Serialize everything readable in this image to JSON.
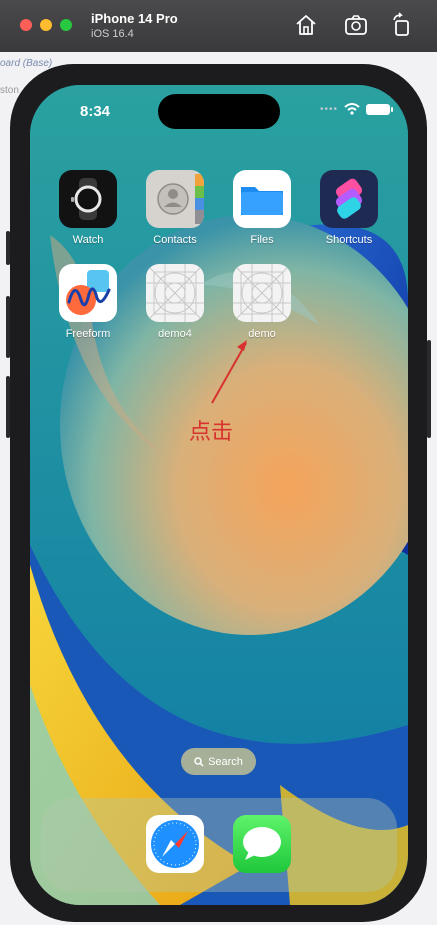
{
  "simulator": {
    "device_name": "iPhone 14 Pro",
    "os_version": "iOS 16.4",
    "toolbar": [
      "home-icon",
      "screenshot-icon",
      "rotate-icon"
    ]
  },
  "background": {
    "partial_text_1": "oard (Base)",
    "partial_text_2": "ston"
  },
  "status_bar": {
    "time": "8:34",
    "signal_dots": "••••"
  },
  "apps_row1": [
    {
      "label": "Watch",
      "icon": "watch-icon"
    },
    {
      "label": "Contacts",
      "icon": "contacts-icon"
    },
    {
      "label": "Files",
      "icon": "files-icon"
    },
    {
      "label": "Shortcuts",
      "icon": "shortcuts-icon"
    }
  ],
  "apps_row2": [
    {
      "label": "Freeform",
      "icon": "freeform-icon"
    },
    {
      "label": "demo4",
      "icon": "placeholder-grid-icon"
    },
    {
      "label": "demo",
      "icon": "placeholder-grid-icon"
    }
  ],
  "annotation": {
    "text": "点击",
    "color": "#d8322f"
  },
  "search": {
    "label": "Search"
  },
  "dock": [
    {
      "icon": "safari-icon"
    },
    {
      "icon": "messages-icon"
    }
  ],
  "colors": {
    "wallpaper_accent_orange": "#f0a050",
    "wallpaper_accent_yellow": "#f2c419",
    "wallpaper_accent_blue": "#1a4ec8"
  }
}
